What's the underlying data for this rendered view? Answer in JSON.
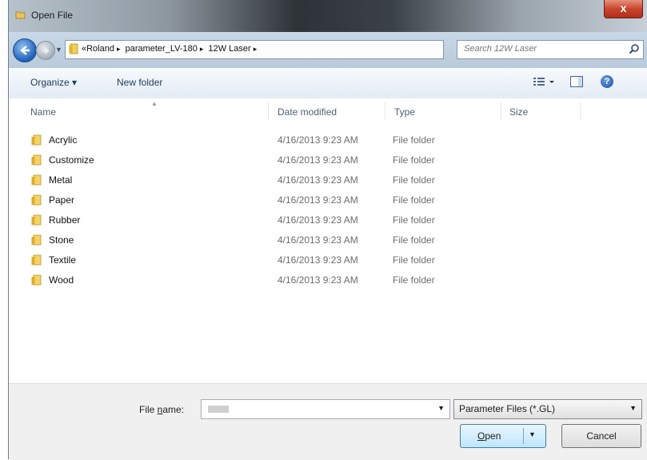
{
  "window": {
    "title": "Open File",
    "close_symbol": "x"
  },
  "address": {
    "crumbs": [
      "«Roland",
      "parameter_LV-180",
      "12W Laser"
    ],
    "separator": "▸",
    "search_placeholder": "Search 12W Laser"
  },
  "toolbar": {
    "organize": "Organize ▾",
    "new_folder": "New folder"
  },
  "columns": {
    "name": "Name",
    "date": "Date modified",
    "type": "Type",
    "size": "Size"
  },
  "files": [
    {
      "name": "Acrylic",
      "date": "4/16/2013 9:23 AM",
      "type": "File folder"
    },
    {
      "name": "Customize",
      "date": "4/16/2013 9:23 AM",
      "type": "File folder"
    },
    {
      "name": "Metal",
      "date": "4/16/2013 9:23 AM",
      "type": "File folder"
    },
    {
      "name": "Paper",
      "date": "4/16/2013 9:23 AM",
      "type": "File folder"
    },
    {
      "name": "Rubber",
      "date": "4/16/2013 9:23 AM",
      "type": "File folder"
    },
    {
      "name": "Stone",
      "date": "4/16/2013 9:23 AM",
      "type": "File folder"
    },
    {
      "name": "Textile",
      "date": "4/16/2013 9:23 AM",
      "type": "File folder"
    },
    {
      "name": "Wood",
      "date": "4/16/2013 9:23 AM",
      "type": "File folder"
    }
  ],
  "footer": {
    "file_name_label_pre": "File ",
    "file_name_label_ul": "n",
    "file_name_label_post": "ame:",
    "file_name_value": "",
    "file_type": "Parameter Files (*.GL)",
    "open_ul": "O",
    "open_rest": "pen",
    "cancel": "Cancel"
  },
  "colors": {
    "folder": "#e8b934",
    "accent": "#3c7fb1",
    "close": "#c9452c"
  }
}
